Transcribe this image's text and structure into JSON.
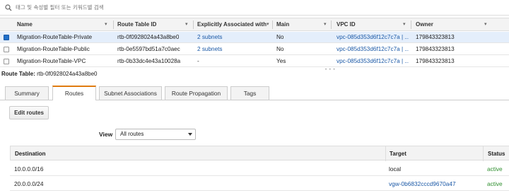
{
  "search": {
    "placeholder": "태그 및 속성별 필터 또는 키워드별 검색"
  },
  "table": {
    "columns": [
      "Name",
      "Route Table ID",
      "Explicitly Associated with",
      "Main",
      "VPC ID",
      "Owner"
    ],
    "rows": [
      {
        "selected": true,
        "name": "Migration-RouteTable-Private",
        "id": "rtb-0f0928024a43a8be0",
        "assoc": "2 subnets",
        "main": "No",
        "vpc": "vpc-085d353d6f12c7c7a | ...",
        "owner": "179843323813"
      },
      {
        "selected": false,
        "name": "Migration-RouteTable-Public",
        "id": "rtb-0e5597bd51a7c0aec",
        "assoc": "2 subnets",
        "main": "No",
        "vpc": "vpc-085d353d6f12c7c7a | ...",
        "owner": "179843323813"
      },
      {
        "selected": false,
        "name": "Migration-RouteTable-VPC",
        "id": "rtb-0b33dc4e43a10028a",
        "assoc": "-",
        "main": "Yes",
        "vpc": "vpc-085d353d6f12c7c7a | ...",
        "owner": "179843323813"
      }
    ]
  },
  "splitter": {
    "dots": "• • •"
  },
  "detail": {
    "label": "Route Table:",
    "value": "rtb-0f0928024a43a8be0",
    "tabs": [
      "Summary",
      "Routes",
      "Subnet Associations",
      "Route Propagation",
      "Tags"
    ],
    "active_tab": "Routes",
    "edit_button": "Edit routes",
    "view_label": "View",
    "view_value": "All routes",
    "routes_columns": [
      "Destination",
      "Target",
      "Status"
    ],
    "routes": [
      {
        "destination": "10.0.0.0/16",
        "target": "local",
        "status": "active"
      },
      {
        "destination": "20.0.0.0/24",
        "target": "vgw-0b6832cccd9670a47",
        "status": "active"
      }
    ]
  },
  "colors": {
    "accent": "#e07b0f",
    "link": "#1a58a6",
    "selected_row": "#e4eefb",
    "status_active": "#2f8f2f"
  }
}
